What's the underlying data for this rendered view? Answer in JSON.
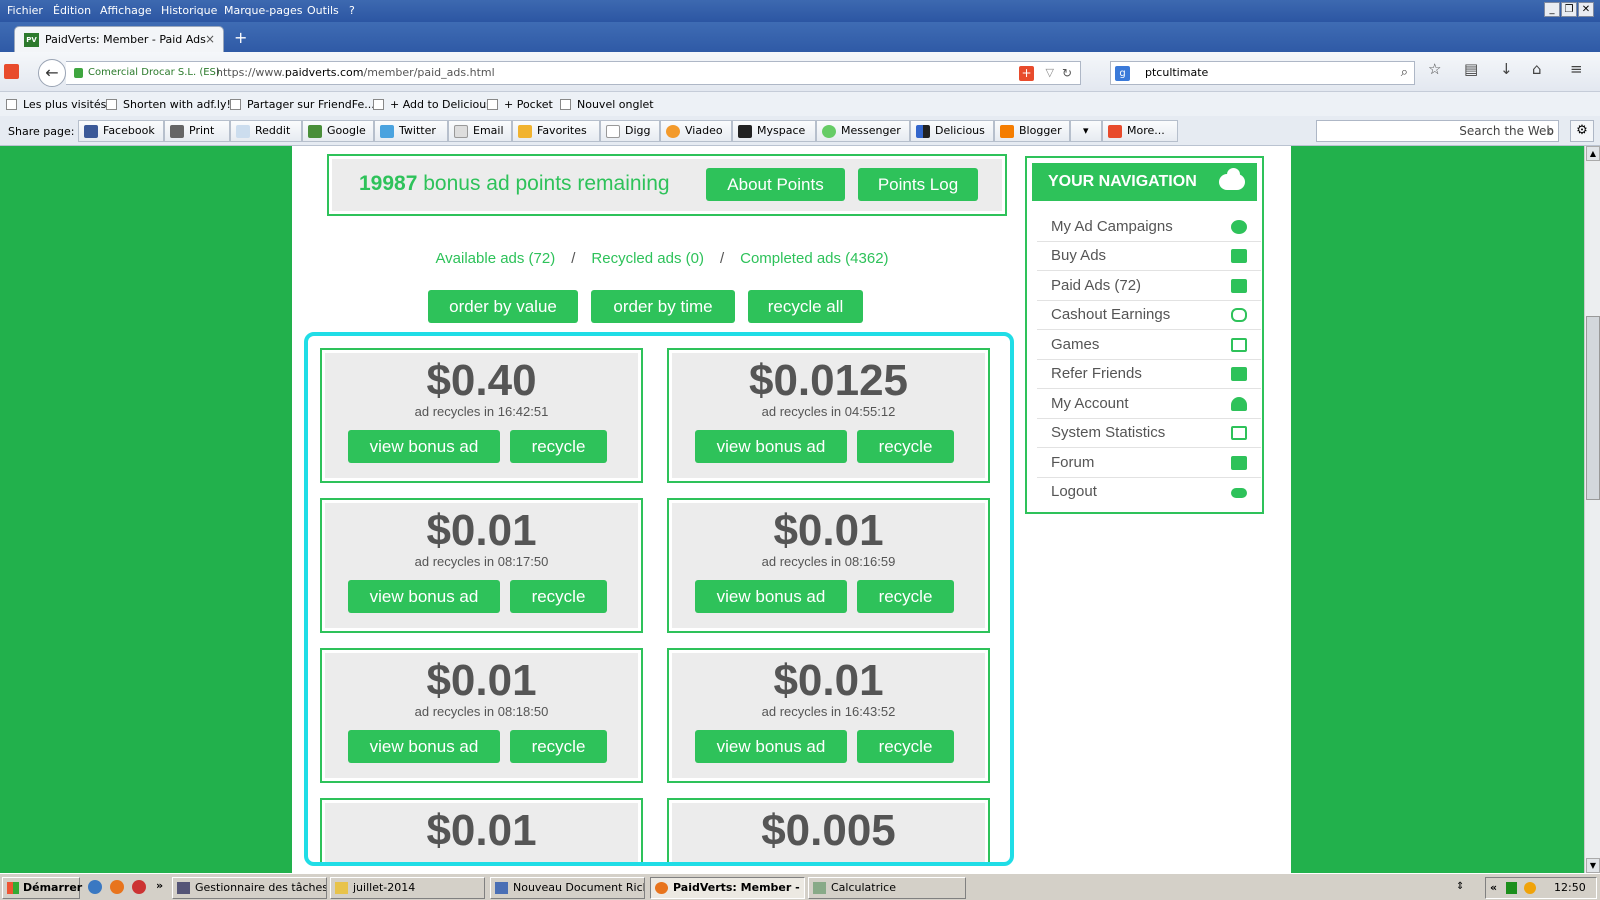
{
  "menu": [
    "Fichier",
    "Édition",
    "Affichage",
    "Historique",
    "Marque-pages",
    "Outils",
    "?"
  ],
  "window_controls": [
    "_",
    "❐",
    "✕"
  ],
  "tab": {
    "favicon_text": "PV",
    "title": "PaidVerts: Member - Paid Ads",
    "close": "×",
    "new_tab": "+"
  },
  "nav": {
    "back_glyph": "←",
    "owner": "Comercial Drocar S.L. (ES)",
    "url_prefix": "https://www.",
    "url_host": "paidverts.com",
    "url_path": "/member/paid_ads.html",
    "addon_glyph": "+",
    "dropdown_glyph": "▽",
    "reload_glyph": "↻",
    "search_engine_glyph": "g",
    "search_query": "ptcultimate",
    "search_glyph": "⌕",
    "right_icons": [
      "☆",
      "▤",
      "↓",
      "⌂",
      "≡"
    ]
  },
  "bookmarks": [
    "Les plus visités",
    "Shorten with adf.ly!",
    "Partager sur FriendFe...",
    "+ Add to Delicious",
    "+ Pocket",
    "Nouvel onglet"
  ],
  "sharebar": {
    "label": "Share page:",
    "buttons": [
      "Facebook",
      "Print",
      "Reddit",
      "Google",
      "Twitter",
      "Email",
      "Favorites",
      "Digg",
      "Viadeo",
      "Myspace",
      "Messenger",
      "Delicious",
      "Blogger",
      "",
      "More..."
    ],
    "dropdown_glyph": "▾",
    "search_placeholder": "Search the Web",
    "search_glyph": "⌕",
    "gear_glyph": "⚙"
  },
  "points": {
    "count": "19987",
    "text": " bonus ad points remaining",
    "about_btn": "About Points",
    "log_btn": "Points Log"
  },
  "filters": {
    "available": "Available ads (72)",
    "recycled": "Recycled ads (0)",
    "completed": "Completed ads (4362)",
    "sep": "/"
  },
  "order": {
    "by_value": "order by value",
    "by_time": "order by time",
    "recycle_all": "recycle all"
  },
  "ads": [
    {
      "value": "$0.40",
      "timer_label": "ad recycles in ",
      "timer": "16:42:51"
    },
    {
      "value": "$0.0125",
      "timer_label": "ad recycles in ",
      "timer": "04:55:12"
    },
    {
      "value": "$0.01",
      "timer_label": "ad recycles in ",
      "timer": "08:17:50"
    },
    {
      "value": "$0.01",
      "timer_label": "ad recycles in ",
      "timer": "08:16:59"
    },
    {
      "value": "$0.01",
      "timer_label": "ad recycles in ",
      "timer": "08:18:50"
    },
    {
      "value": "$0.01",
      "timer_label": "ad recycles in ",
      "timer": "16:43:52"
    },
    {
      "value": "$0.01",
      "timer_label": "",
      "timer": ""
    },
    {
      "value": "$0.005",
      "timer_label": "",
      "timer": ""
    }
  ],
  "ad_buttons": {
    "view": "view bonus ad",
    "recycle": "recycle"
  },
  "navigation": {
    "title": "YOUR NAVIGATION",
    "items": [
      {
        "label": "My Ad Campaigns",
        "icon": "share-icon"
      },
      {
        "label": "Buy Ads",
        "icon": "money-icon"
      },
      {
        "label": "Paid Ads (72)",
        "icon": "forward-icon"
      },
      {
        "label": "Cashout Earnings",
        "icon": "money-bag-icon"
      },
      {
        "label": "Games",
        "icon": "dice-icon"
      },
      {
        "label": "Refer Friends",
        "icon": "sitemap-icon"
      },
      {
        "label": "My Account",
        "icon": "user-icon"
      },
      {
        "label": "System Statistics",
        "icon": "chart-icon"
      },
      {
        "label": "Forum",
        "icon": "list-icon"
      },
      {
        "label": "Logout",
        "icon": "cloud-icon"
      }
    ]
  },
  "scroll": {
    "up": "▲",
    "down": "▼"
  },
  "taskbar": {
    "start": "Démarrer",
    "chevron": "»",
    "items": [
      "Gestionnaire des tâches ...",
      "juillet-2014",
      "Nouveau Document Rich ...",
      "PaidVerts: Member - ...",
      "Calculatrice"
    ],
    "tray_chevron": "«",
    "time": "12:50"
  },
  "colors": {
    "accent": "#2ec25a",
    "page_bg": "#22b14c",
    "highlight": "#20dde6",
    "value_text": "#555555"
  }
}
